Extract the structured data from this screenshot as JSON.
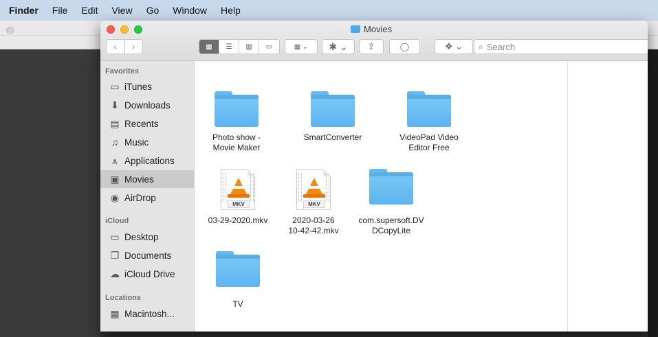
{
  "menubar": {
    "items": [
      "Finder",
      "File",
      "Edit",
      "View",
      "Go",
      "Window",
      "Help"
    ]
  },
  "window": {
    "title": "Movies",
    "title_icon": "folder-icon"
  },
  "toolbar": {
    "back_glyph": "‹",
    "forward_glyph": "›",
    "view_modes": [
      "icon-view-icon",
      "list-view-icon",
      "column-view-icon",
      "gallery-view-icon"
    ],
    "arrange_glyph": "▦ ⌄",
    "action_glyph": "✱ ⌄",
    "share_glyph": "⇪",
    "tags_glyph": "◯",
    "dropbox_glyph": "❖ ⌄",
    "search_placeholder": "Search"
  },
  "sidebar": {
    "favorites_heading": "Favorites",
    "favorites": [
      {
        "label": "iTunes",
        "icon": "folder-icon"
      },
      {
        "label": "Downloads",
        "icon": "download-icon"
      },
      {
        "label": "Recents",
        "icon": "recents-icon"
      },
      {
        "label": "Music",
        "icon": "music-icon"
      },
      {
        "label": "Applications",
        "icon": "applications-icon"
      },
      {
        "label": "Movies",
        "icon": "film-icon",
        "selected": true
      },
      {
        "label": "AirDrop",
        "icon": "airdrop-icon"
      }
    ],
    "icloud_heading": "iCloud",
    "icloud": [
      {
        "label": "Desktop",
        "icon": "desktop-icon"
      },
      {
        "label": "Documents",
        "icon": "documents-icon"
      },
      {
        "label": "iCloud Drive",
        "icon": "cloud-icon"
      }
    ],
    "locations_heading": "Locations",
    "locations": [
      {
        "label": "Macintosh...",
        "icon": "harddrive-icon"
      }
    ]
  },
  "files": [
    {
      "name_line1": "Photo show -",
      "name_line2": "Movie Maker",
      "kind": "folder"
    },
    {
      "name_line1": "SmartConverter",
      "name_line2": "",
      "kind": "folder"
    },
    {
      "name_line1": "VideoPad Video",
      "name_line2": "Editor Free",
      "kind": "folder"
    },
    {
      "name_line1": "03-29-2020.mkv",
      "name_line2": "",
      "kind": "mkv",
      "ext": "MKV"
    },
    {
      "name_line1": "2020-03-26",
      "name_line2": "10-42-42.mkv",
      "kind": "mkv",
      "ext": "MKV"
    },
    {
      "name_line1": "com.supersoft.DV",
      "name_line2": "DCopyLite",
      "kind": "folder"
    },
    {
      "name_line1": "TV",
      "name_line2": "",
      "kind": "folder"
    }
  ],
  "colors": {
    "menubar": "#c9d9ec",
    "folder": "#6cbdf5",
    "selection": "#cbcbcb",
    "vlc_orange": "#f08a12"
  }
}
